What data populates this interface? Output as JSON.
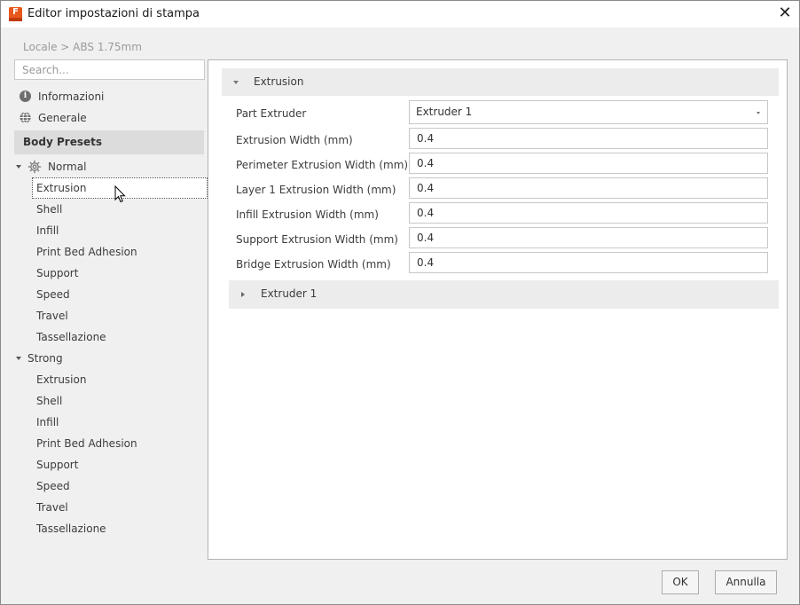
{
  "window": {
    "title": "Editor impostazioni di stampa",
    "app_icon_letter": "F"
  },
  "breadcrumb": "Locale > ABS 1.75mm",
  "search": {
    "placeholder": "Search...",
    "value": ""
  },
  "sidebar": {
    "top_items": [
      {
        "label": "Informazioni",
        "icon": "info-icon"
      },
      {
        "label": "Generale",
        "icon": "globe-icon"
      }
    ],
    "section_header": "Body Presets",
    "presets": [
      {
        "label": "Normal",
        "icon": "gear-icon",
        "expanded": true,
        "children": [
          "Extrusion",
          "Shell",
          "Infill",
          "Print Bed Adhesion",
          "Support",
          "Speed",
          "Travel",
          "Tassellazione"
        ]
      },
      {
        "label": "Strong",
        "expanded": true,
        "children": [
          "Extrusion",
          "Shell",
          "Infill",
          "Print Bed Adhesion",
          "Support",
          "Speed",
          "Travel",
          "Tassellazione"
        ]
      }
    ],
    "selected": "Normal > Extrusion"
  },
  "main": {
    "group": {
      "title": "Extrusion",
      "expanded": true
    },
    "part_extruder": {
      "label": "Part Extruder",
      "value": "Extruder 1"
    },
    "fields": [
      {
        "label": "Extrusion Width (mm)",
        "value": "0.4"
      },
      {
        "label": "Perimeter Extrusion Width (mm)",
        "value": "0.4"
      },
      {
        "label": "Layer 1 Extrusion Width (mm)",
        "value": "0.4"
      },
      {
        "label": "Infill Extrusion Width (mm)",
        "value": "0.4"
      },
      {
        "label": "Support Extrusion Width (mm)",
        "value": "0.4"
      },
      {
        "label": "Bridge Extrusion Width (mm)",
        "value": "0.4"
      }
    ],
    "subgroup": {
      "title": "Extruder 1",
      "expanded": false
    }
  },
  "footer": {
    "ok_label": "OK",
    "cancel_label": "Annulla"
  },
  "colors": {
    "app_icon": "#e8581c",
    "section_header_bg": "#dcdcdc",
    "group_header_bg": "#ececec"
  }
}
